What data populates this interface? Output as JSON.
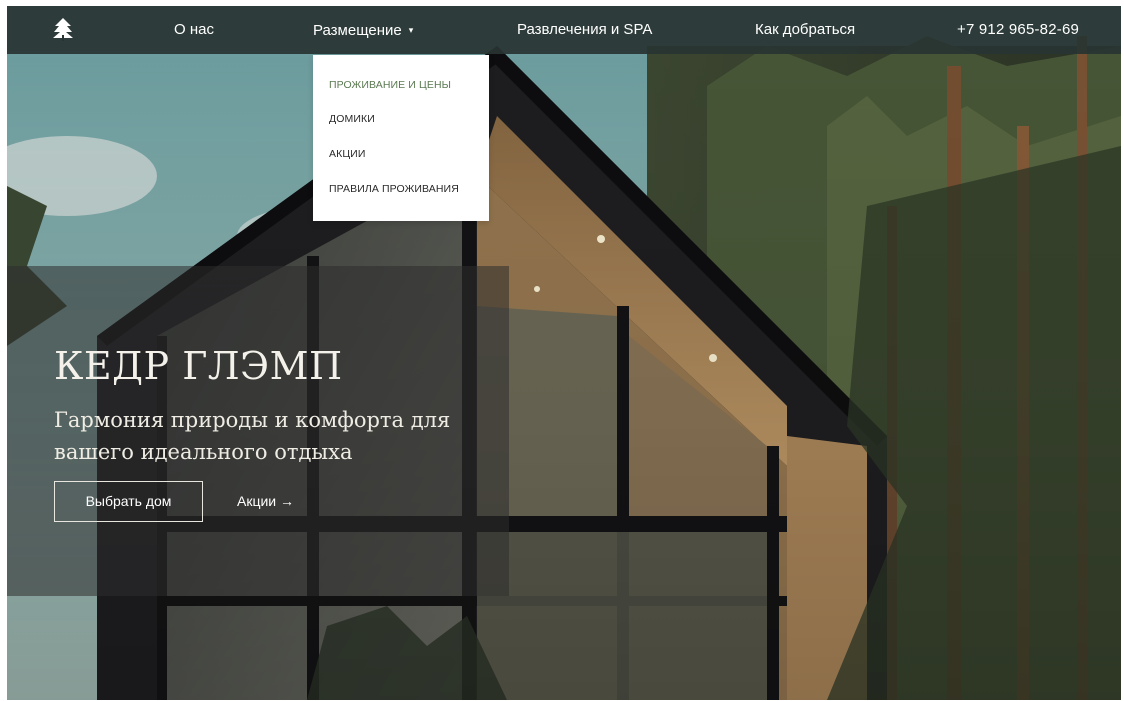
{
  "navbar": {
    "logo_icon": "pine-tree-icon",
    "items": [
      {
        "label": "О нас"
      },
      {
        "label": "Размещение",
        "caret": "▾"
      },
      {
        "label": "Развлечения и SPA"
      },
      {
        "label": "Как добраться"
      }
    ],
    "phone": "+7 912 965-82-69"
  },
  "dropdown": {
    "items": [
      {
        "label": "ПРОЖИВАНИЕ И ЦЕНЫ",
        "active": true
      },
      {
        "label": "ДОМИКИ"
      },
      {
        "label": "АКЦИИ"
      },
      {
        "label": "ПРАВИЛА ПРОЖИВАНИЯ"
      }
    ]
  },
  "hero": {
    "title": "КЕДР ГЛЭМП",
    "subtitle": "Гармония природы и комфорта для вашего идеального отдыха",
    "primary_button": "Выбрать дом",
    "secondary_link": "Акции →"
  },
  "colors": {
    "navbar_bg": "#283432",
    "accent_green": "#5b7a52",
    "text_light": "#ffffff"
  }
}
